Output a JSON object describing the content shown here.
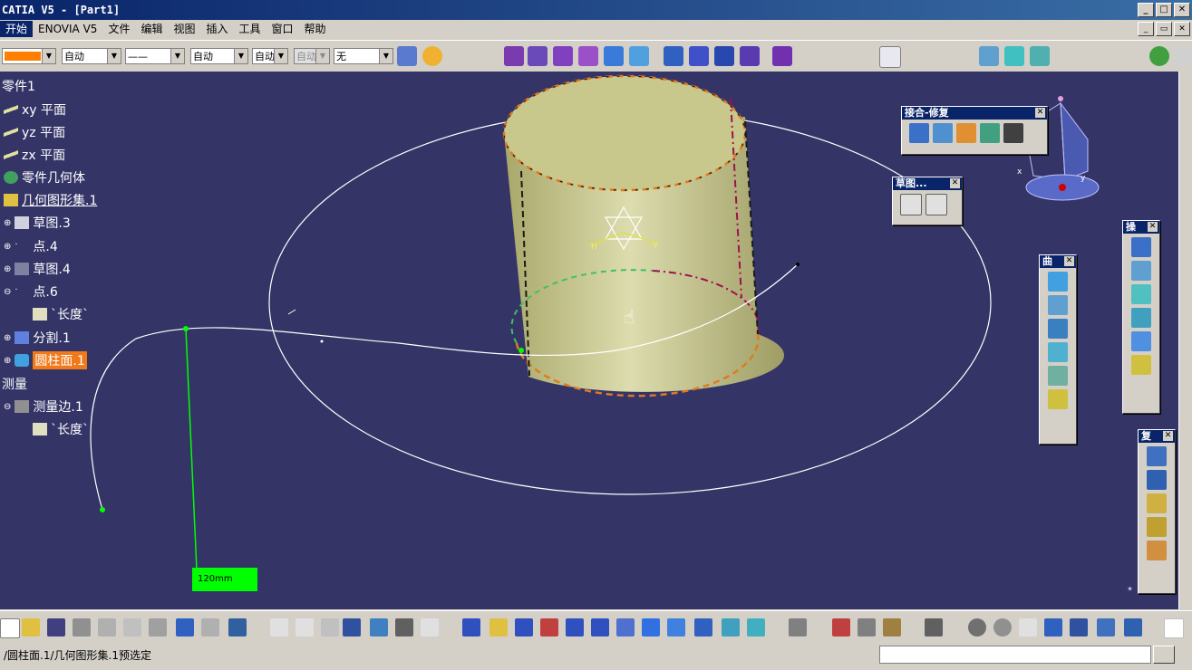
{
  "window": {
    "title": "CATIA V5 - [Part1]"
  },
  "menu": {
    "items": [
      "开始",
      "ENOVIA V5",
      "文件",
      "编辑",
      "视图",
      "插入",
      "工具",
      "窗口",
      "帮助"
    ]
  },
  "props_toolbar": {
    "color_value": "",
    "linetype_value": "自动",
    "lineweight_value": "——",
    "layer_value": "自动",
    "filter_value": "自动",
    "filter2_value": "自动",
    "none_value": "无"
  },
  "tree": {
    "root": "零件1",
    "xy": "xy 平面",
    "yz": "yz 平面",
    "zx": "zx 平面",
    "body": "零件几何体",
    "geoset": "几何图形集.1",
    "sketch3": "草图.3",
    "point4": "点.4",
    "sketch4": "草图.4",
    "point6": "点.6",
    "length1": "`长度`",
    "split1": "分割.1",
    "cylinder1": "圆柱面.1",
    "measure": "测量",
    "measure_edge": "测量边.1",
    "length2": "`长度`"
  },
  "panels": {
    "join_heal": {
      "title": "接合-修复"
    },
    "sketch": {
      "title": "草图..."
    },
    "surfaces": {
      "title": "曲"
    },
    "operations": {
      "title": "操"
    },
    "replication": {
      "title": "复"
    }
  },
  "viewport": {
    "measure_label": "120mm",
    "compass_x": "x",
    "compass_y": "y",
    "compass_v": "V",
    "compass_h": "H"
  },
  "status": {
    "message": "/圆柱面.1/几何图形集.1预选定"
  },
  "colors": {
    "viewport_bg": "#343467",
    "selection": "#f07a1a",
    "measure": "#00ff00",
    "titlebar": "#0a246a"
  }
}
